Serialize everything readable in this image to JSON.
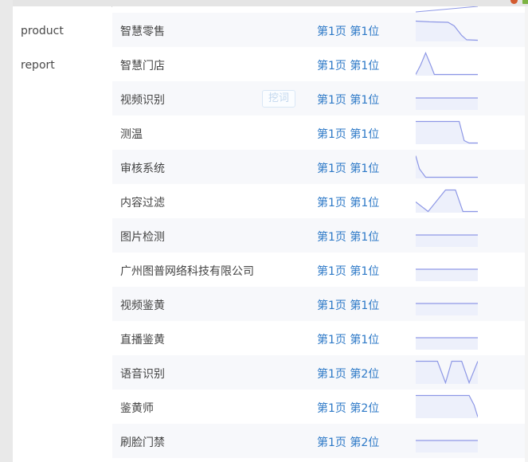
{
  "sidebar": {
    "items": [
      {
        "label": "product"
      },
      {
        "label": "report"
      }
    ]
  },
  "tag": {
    "label": "挖词"
  },
  "rows": [
    {
      "name": "智慧零售",
      "rank": "第1页 第1位",
      "alt": true,
      "spark": "0.00,0.15 0.22,0.18 0.52,0.20 0.62,0.35 0.74,0.75 0.82,0.93 1.00,0.95"
    },
    {
      "name": "智慧门店",
      "rank": "第1页 第1位",
      "alt": false,
      "spark": "0.00,0.95 0.08,0.55 0.16,0.05 0.24,0.55 0.30,0.95 1.00,0.95"
    },
    {
      "name": "视频识别",
      "rank": "第1页 第1位",
      "alt": true,
      "tag": true,
      "spark": "0.00,0.50 1.00,0.50"
    },
    {
      "name": "测温",
      "rank": "第1页 第1位",
      "alt": false,
      "spark": "0.00,0.05 0.70,0.05 0.78,0.85 0.86,0.95 1.00,0.95"
    },
    {
      "name": "审核系统",
      "rank": "第1页 第1位",
      "alt": true,
      "spark": "0.00,0.05 0.06,0.60 0.16,0.95 1.00,0.95"
    },
    {
      "name": "内容过滤",
      "rank": "第1页 第1位",
      "alt": false,
      "spark": "0.00,0.55 0.20,0.95 0.48,0.05 0.64,0.05 0.76,0.95 1.00,0.95"
    },
    {
      "name": "图片检测",
      "rank": "第1页 第1位",
      "alt": true,
      "spark": "0.00,0.50 1.00,0.50"
    },
    {
      "name": "广州图普网络科技有限公司",
      "rank": "第1页 第1位",
      "alt": false,
      "spark": "0.00,0.50 1.00,0.50"
    },
    {
      "name": "视频鉴黄",
      "rank": "第1页 第1位",
      "alt": true,
      "spark": "0.00,0.50 1.00,0.50"
    },
    {
      "name": "直播鉴黄",
      "rank": "第1页 第1位",
      "alt": false,
      "spark": "0.00,0.50 1.00,0.50"
    },
    {
      "name": "语音识别",
      "rank": "第1页 第2位",
      "alt": true,
      "spark": "0.00,0.05 0.35,0.05 0.48,0.95 0.58,0.05 0.74,0.05 0.86,0.95 1.00,0.05"
    },
    {
      "name": "鉴黄师",
      "rank": "第1页 第2位",
      "alt": false,
      "spark": "0.00,0.05 0.86,0.05 0.94,0.45 1.00,0.95"
    },
    {
      "name": "刷脸门禁",
      "rank": "第1页 第2位",
      "alt": true,
      "spark": "0.00,0.50 1.00,0.50"
    }
  ],
  "colors": {
    "rank": "#2d79c7",
    "spark_line": "#8e98e6",
    "spark_fill": "#edf0fb"
  }
}
